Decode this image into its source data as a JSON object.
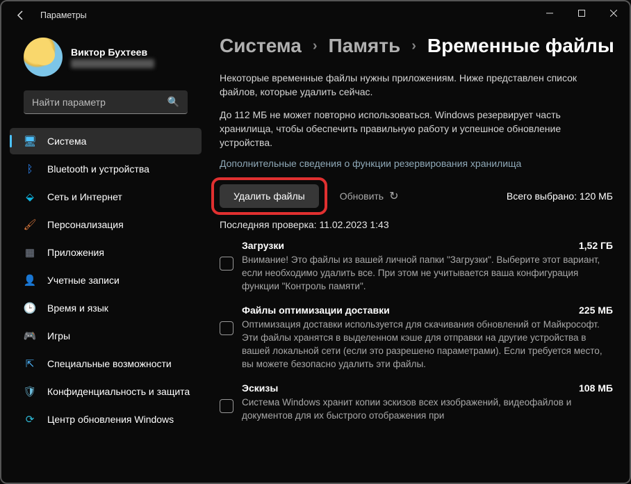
{
  "window": {
    "title": "Параметры"
  },
  "user": {
    "name": "Виктор Бухтеев"
  },
  "search": {
    "placeholder": "Найти параметр"
  },
  "nav": {
    "items": [
      {
        "label": "Система",
        "icon": "system",
        "active": true,
        "iconColor": "#4cc2ff"
      },
      {
        "label": "Bluetooth и устройства",
        "icon": "bluetooth",
        "iconColor": "#2f8cff"
      },
      {
        "label": "Сеть и Интернет",
        "icon": "wifi",
        "iconColor": "#0fb5e0"
      },
      {
        "label": "Персонализация",
        "icon": "brush",
        "iconColor": "#e07b3e"
      },
      {
        "label": "Приложения",
        "icon": "apps",
        "iconColor": "#7a8290"
      },
      {
        "label": "Учетные записи",
        "icon": "account",
        "iconColor": "#d86868"
      },
      {
        "label": "Время и язык",
        "icon": "time",
        "iconColor": "#3fc9a3"
      },
      {
        "label": "Игры",
        "icon": "games",
        "iconColor": "#9f9f9f"
      },
      {
        "label": "Специальные возможности",
        "icon": "access",
        "iconColor": "#4cb0f5"
      },
      {
        "label": "Конфиденциальность и защита",
        "icon": "shield",
        "iconColor": "#6bb9d8"
      },
      {
        "label": "Центр обновления Windows",
        "icon": "update",
        "iconColor": "#2eb9d6"
      }
    ]
  },
  "breadcrumb": {
    "a": "Система",
    "b": "Память",
    "c": "Временные файлы"
  },
  "page": {
    "desc1": "Некоторые временные файлы нужны приложениям. Ниже представлен список файлов, которые удалить сейчас.",
    "desc2": "До 112 МБ не может повторно использоваться. Windows резервирует часть хранилища, чтобы обеспечить правильную работу и успешное обновление устройства.",
    "link": "Дополнительные сведения о функции резервирования хранилища",
    "delete_label": "Удалить файлы",
    "refresh_label": "Обновить",
    "total_prefix": "Всего выбрано:",
    "total_value": "120 МБ",
    "last_check_prefix": "Последняя проверка:",
    "last_check_value": "11.02.2023 1:43",
    "items": [
      {
        "title": "Загрузки",
        "size": "1,52 ГБ",
        "text": "Внимание! Это файлы из вашей личной папки \"Загрузки\". Выберите этот вариант, если необходимо удалить все. При этом не учитывается ваша конфигурация функции \"Контроль памяти\"."
      },
      {
        "title": "Файлы оптимизации доставки",
        "size": "225 МБ",
        "text": "Оптимизация доставки используется для скачивания обновлений от Майкрософт. Эти файлы хранятся в выделенном кэше для отправки на другие устройства в вашей локальной сети (если это разрешено параметрами). Если требуется место, вы можете безопасно удалить эти файлы."
      },
      {
        "title": "Эскизы",
        "size": "108 МБ",
        "text": "Система Windows хранит копии эскизов всех изображений, видеофайлов и документов для их быстрого отображения при"
      }
    ]
  },
  "icon_glyphs": {
    "system": "🖥",
    "bluetooth": "ᛒ",
    "wifi": "⬙",
    "brush": "🖌",
    "apps": "▦",
    "account": "👤",
    "time": "🕒",
    "games": "🎮",
    "access": "⇱",
    "shield": "🛡",
    "update": "⟳",
    "search": "🔍",
    "refresh": "↻"
  }
}
